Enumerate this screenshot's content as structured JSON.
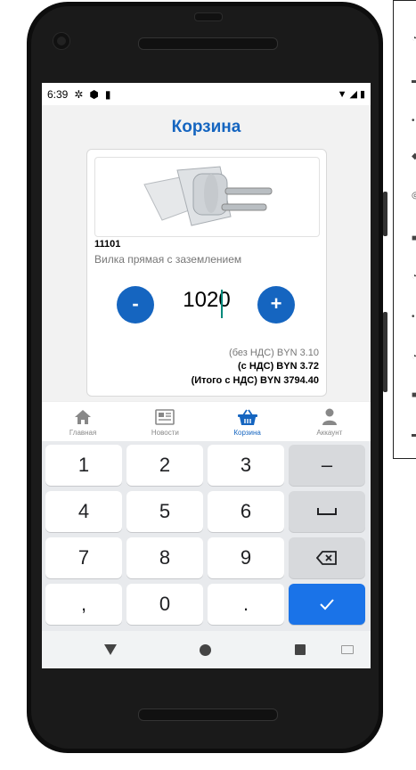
{
  "status_bar": {
    "time": "6:39"
  },
  "header": {
    "title": "Корзина"
  },
  "product": {
    "sku": "11101",
    "name": "Вилка прямая с заземлением",
    "quantity": "1020",
    "minus_label": "-",
    "plus_label": "+",
    "price_no_vat": "(без НДС) BYN 3.10",
    "price_vat": "(с НДС) BYN 3.72",
    "total_vat": "(Итого с НДС) BYN 3794.40"
  },
  "nav": {
    "items": [
      {
        "label": "Главная",
        "icon": "home-icon"
      },
      {
        "label": "Новости",
        "icon": "newspaper-icon"
      },
      {
        "label": "Корзина",
        "icon": "basket-icon",
        "active": true
      },
      {
        "label": "Аккаунт",
        "icon": "user-icon"
      }
    ]
  },
  "keyboard": {
    "keys": [
      "1",
      "2",
      "3",
      "–",
      "4",
      "5",
      "6",
      "␣",
      "7",
      "8",
      "9",
      "⌫",
      ",",
      "0",
      ".",
      "✓"
    ]
  },
  "colors": {
    "accent": "#1565c0",
    "confirm_key": "#1a73e8"
  }
}
